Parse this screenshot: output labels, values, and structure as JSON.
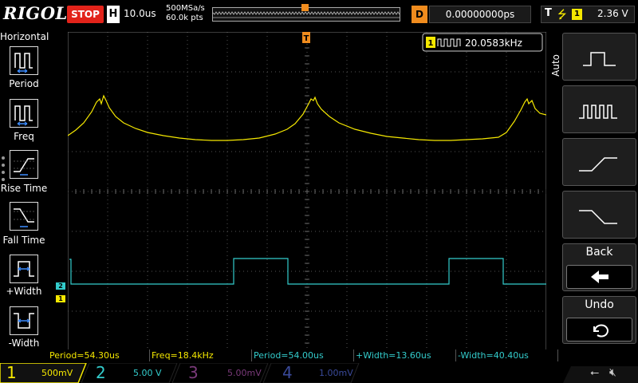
{
  "app": {
    "brand": "RIGOL"
  },
  "topbar": {
    "run_state": "STOP",
    "horizontal_badge": "H",
    "timebase": "10.0us",
    "sample_rate": "500MSa/s",
    "memory_depth": "60.0k pts",
    "delay_badge": "D",
    "delay_value": "0.00000000ps",
    "trigger": {
      "label": "T",
      "edge_icon": "rising-edge-icon",
      "source": "1",
      "level": "2.36 V"
    }
  },
  "left_panel": {
    "title": "Horizontal",
    "items": [
      {
        "label": "Period",
        "icon": "period-icon"
      },
      {
        "label": "Freq",
        "icon": "freq-icon"
      },
      {
        "label": "Rise Time",
        "icon": "rise-time-icon"
      },
      {
        "label": "Fall Time",
        "icon": "fall-time-icon"
      },
      {
        "label": "+Width",
        "icon": "positive-width-icon"
      },
      {
        "label": "-Width",
        "icon": "negative-width-icon"
      }
    ]
  },
  "right_panel": {
    "auto_label": "Auto",
    "buttons": [
      {
        "title": "",
        "icon": "single-pulse-icon"
      },
      {
        "title": "",
        "icon": "pulse-train-icon"
      },
      {
        "title": "",
        "icon": "rising-edge-icon"
      },
      {
        "title": "",
        "icon": "falling-edge-icon"
      },
      {
        "title": "Back",
        "icon": "back-arrow-icon"
      },
      {
        "title": "Undo",
        "icon": "undo-icon"
      }
    ]
  },
  "screen": {
    "freq_counter": {
      "channel": "1",
      "value": "20.0583kHz"
    },
    "ch1_marker": "1",
    "ch2_marker": "2",
    "trigger_level_marker": "T",
    "trigger_pos_marker": "T"
  },
  "measurements": [
    {
      "text": "Period=54.30us",
      "channel": "1"
    },
    {
      "text": "Freq=18.4kHz",
      "channel": "1"
    },
    {
      "text": "Period=54.00us",
      "channel": "2"
    },
    {
      "text": "+Width=13.60us",
      "channel": "2"
    },
    {
      "text": "-Width=40.40us",
      "channel": "2"
    }
  ],
  "channels": [
    {
      "num": "1",
      "scale": "500mV",
      "color": "#f5e800",
      "active": true
    },
    {
      "num": "2",
      "scale": "5.00 V",
      "color": "#33cccc",
      "active": false
    },
    {
      "num": "3",
      "scale": "5.00mV",
      "color": "#c040c0",
      "active": false
    },
    {
      "num": "4",
      "scale": "1.00mV",
      "color": "#3060ff",
      "active": false
    }
  ],
  "status_icons": {
    "usb": "usb-icon",
    "speaker": "speaker-muted-icon"
  },
  "colors": {
    "ch1": "#f5e800",
    "ch2": "#33cccc",
    "trigger": "#f08c1e",
    "stop": "#e2231a"
  }
}
